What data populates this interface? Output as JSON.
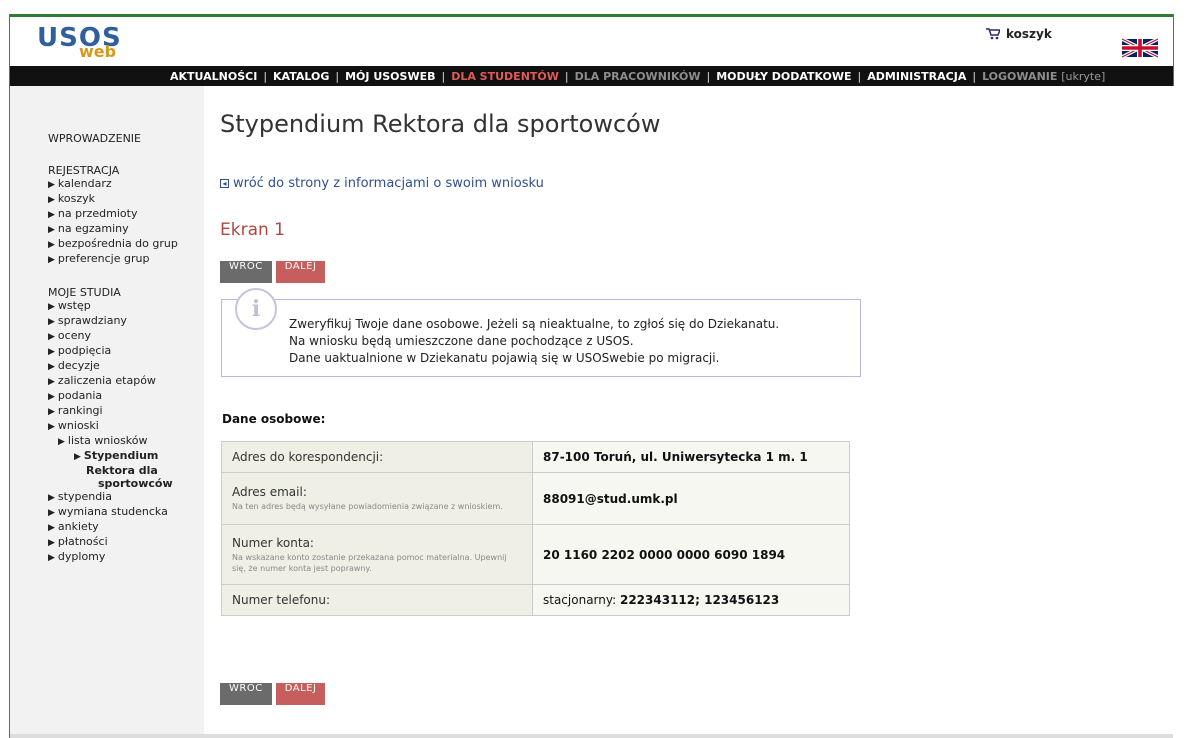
{
  "header": {
    "logo_top": "USOS",
    "logo_bottom": "web",
    "cart_label": "koszyk",
    "language_flag": "uk-flag-icon"
  },
  "nav": {
    "items": [
      "AKTUALNOŚCI",
      "KATALOG",
      "MÓJ USOSWEB",
      "DLA STUDENTÓW",
      "DLA PRACOWNIKÓW",
      "MODUŁY DODATKOWE",
      "ADMINISTRACJA",
      "LOGOWANIE",
      "[ukryte]"
    ],
    "active_color": "#e05a5a"
  },
  "sidebar": {
    "intro": "WPROWADZENIE",
    "reg_header": "REJESTRACJA",
    "reg_items": [
      "kalendarz",
      "koszyk",
      "na przedmioty",
      "na egzaminy",
      "bezpośrednia do grup",
      "preferencje grup"
    ],
    "studies_header": "MOJE STUDIA",
    "studies_items": [
      "wstęp",
      "sprawdziany",
      "oceny",
      "podpięcia",
      "decyzje",
      "zaliczenia etapów",
      "podania",
      "rankingi",
      "wnioski"
    ],
    "sub_item": "lista wniosków",
    "current": [
      "Stypendium",
      "Rektora dla",
      "sportowców"
    ],
    "after_items": [
      "stypendia",
      "wymiana studencka",
      "ankiety",
      "płatności",
      "dyplomy"
    ]
  },
  "main": {
    "title": "Stypendium Rektora dla sportowców",
    "back_link": "wróć do strony z informacjami o swoim wniosku",
    "screen_title": "Ekran 1",
    "btn_back": "WRÓĆ",
    "btn_next": "DALEJ",
    "info_lines": [
      "Zweryfikuj Twoje dane osobowe. Jeżeli są nieaktualne, to zgłoś się do Dziekanatu.",
      "Na wniosku będą umieszczone dane pochodzące z USOS.",
      "Dane uaktualnione w Dziekanatu pojawią się w USOSwebie po migracji."
    ],
    "section_title": "Dane osobowe:",
    "rows": [
      {
        "label": "Adres do korespondencji:",
        "note": "",
        "value": "87-100 Toruń, ul. Uniwersytecka 1 m. 1"
      },
      {
        "label": "Adres email:",
        "note": "Na ten adres będą wysyłane powiadomienia związane z wnioskiem.",
        "value": "88091@stud.umk.pl"
      },
      {
        "label": "Numer konta:",
        "note": "Na wskazane konto zostanie przekazana pomoc materialna. Upewnij się, że numer konta jest poprawny.",
        "value": "20 1160 2202 0000 0000 6090 1894"
      },
      {
        "label": "Numer telefonu:",
        "note": "",
        "value_prefix": "stacjonarny: ",
        "value": "222343112; 123456123"
      }
    ]
  }
}
